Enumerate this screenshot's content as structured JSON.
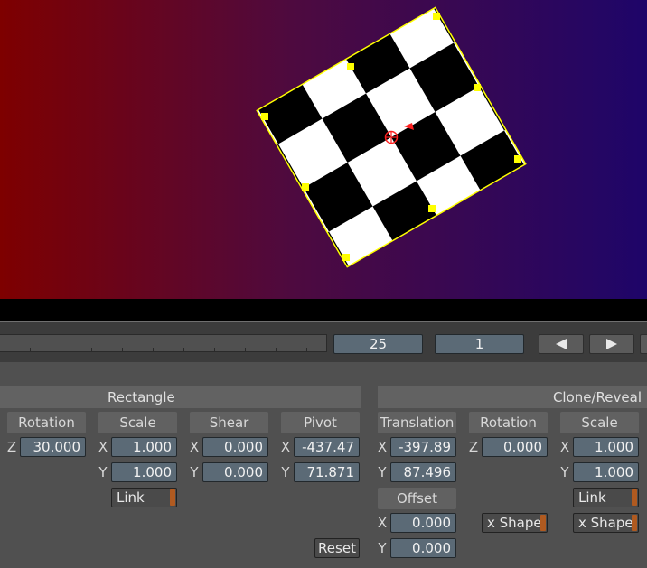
{
  "viewer": {
    "gradient_colors": [
      "#7e0000",
      "#4e0a3f",
      "#1e0569"
    ],
    "checker_dark": "#000000",
    "checker_light": "#ffffff",
    "outline_color": "#ffff00",
    "pivot_color": "#ff2020"
  },
  "timeline": {
    "frame_field": "25",
    "current_frame": "1",
    "prev_icon": "play-left-icon",
    "next_icon": "play-right-icon"
  },
  "rectangle": {
    "title": "Rectangle",
    "rotation": {
      "label": "Rotation",
      "z_axis": "Z",
      "z": "30.000"
    },
    "scale": {
      "label": "Scale",
      "x_axis": "X",
      "x": "1.000",
      "y_axis": "Y",
      "y": "1.000",
      "link_label": "Link"
    },
    "shear": {
      "label": "Shear",
      "x_axis": "X",
      "x": "0.000",
      "y_axis": "Y",
      "y": "0.000"
    },
    "pivot": {
      "label": "Pivot",
      "x_axis": "X",
      "x": "-437.47",
      "y_axis": "Y",
      "y": "71.871"
    },
    "reset_label": "Reset"
  },
  "clone_reveal": {
    "title": "Clone/Reveal",
    "translation": {
      "label": "Translation",
      "x_axis": "X",
      "x": "-397.89",
      "y_axis": "Y",
      "y": "87.496"
    },
    "offset": {
      "label": "Offset",
      "x_axis": "X",
      "x": "0.000",
      "y_axis": "Y",
      "y": "0.000"
    },
    "rotation": {
      "label": "Rotation",
      "z_axis": "Z",
      "z": "0.000",
      "shape_label": "x Shape"
    },
    "scale": {
      "label": "Scale",
      "x_axis": "X",
      "x": "1.000",
      "y_axis": "Y",
      "y": "1.000",
      "link_label": "Link",
      "shape_label": "x Shape"
    }
  }
}
